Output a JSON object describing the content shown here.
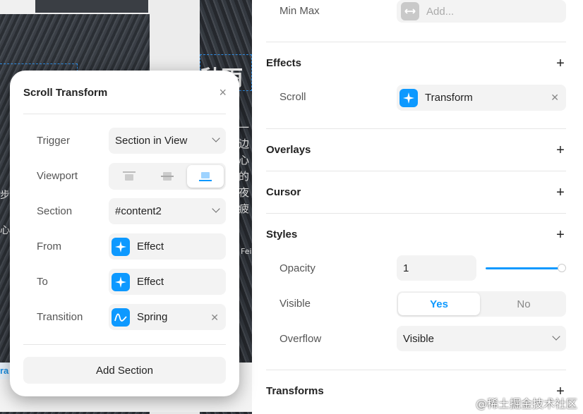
{
  "canvas": {
    "heading_fragment": "秋雨",
    "text_lines": [
      "一",
      "边",
      "心",
      "的",
      "夜",
      "疲"
    ],
    "left_fragments": [
      "步",
      "心"
    ],
    "caption": "Fei",
    "bottom_fragment": "ra"
  },
  "panel": {
    "min_max": {
      "label": "Min Max",
      "placeholder": "Add...",
      "icon": "resize-icon"
    },
    "effects": {
      "title": "Effects",
      "scroll_label": "Scroll",
      "scroll_value": "Transform",
      "scroll_icon": "sparkle-icon"
    },
    "overlays": {
      "title": "Overlays"
    },
    "cursor": {
      "title": "Cursor"
    },
    "styles": {
      "title": "Styles",
      "opacity_label": "Opacity",
      "opacity_value": "1",
      "opacity_level": 1,
      "visible_label": "Visible",
      "visible_yes": "Yes",
      "visible_no": "No",
      "overflow_label": "Overflow",
      "overflow_value": "Visible"
    },
    "transforms": {
      "title": "Transforms"
    },
    "plus": "+"
  },
  "modal": {
    "title": "Scroll Transform",
    "close": "×",
    "trigger": {
      "label": "Trigger",
      "value": "Section in View"
    },
    "viewport": {
      "label": "Viewport",
      "options": [
        "top",
        "center",
        "bottom"
      ],
      "selected": "bottom"
    },
    "section": {
      "label": "Section",
      "value": "#content2"
    },
    "from": {
      "label": "From",
      "value": "Effect"
    },
    "to": {
      "label": "To",
      "value": "Effect"
    },
    "transition": {
      "label": "Transition",
      "value": "Spring"
    },
    "add_section": "Add Section"
  },
  "colors": {
    "accent": "#0d99ff"
  },
  "watermark": "@稀土掘金技术社区"
}
